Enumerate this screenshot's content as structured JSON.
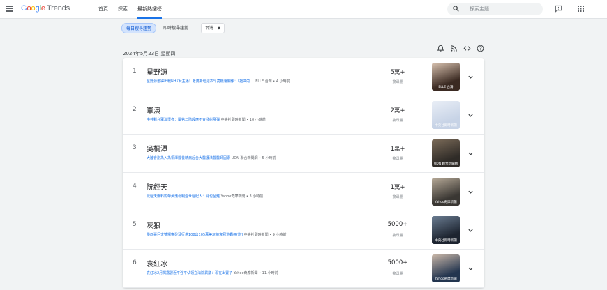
{
  "header": {
    "logo": {
      "google": [
        "G",
        "o",
        "o",
        "g",
        "l",
        "e"
      ],
      "product": "Trends"
    },
    "nav": [
      {
        "label": "首頁"
      },
      {
        "label": "探索"
      },
      {
        "label": "最新熱搜榜"
      }
    ],
    "search_placeholder": "探索主題"
  },
  "filters": {
    "daily_label": "每日搜尋趨勢",
    "realtime_label": "即時搜尋趨勢",
    "region": "台灣"
  },
  "date": "2024年5月23日 星期四",
  "count_label": "搜尋量",
  "trends": [
    {
      "rank": "1",
      "title": "星野源",
      "article": "星野源邀得出戰NHK女主播！老婆新垣結衣早亮機會關係：「扭曲的 ...",
      "source": "ELLE 台灣",
      "time": "4 小時前",
      "count": "5萬+",
      "thumb_source": "ELLE 台灣",
      "thumb_colors": [
        "#3b2a22",
        "#d8c2b0"
      ]
    },
    {
      "rank": "2",
      "title": "軍演",
      "article": "中共對台軍演學者：屬第二階段應不會發射飛彈",
      "source": "中央社即時新聞",
      "time": "10 小時前",
      "count": "2萬+",
      "thumb_source": "中央社即時新聞",
      "thumb_colors": [
        "#c7d3e6",
        "#e9eef6"
      ]
    },
    {
      "rank": "3",
      "title": "吳桐潭",
      "article": "大陸會劃為入為桐潭醫養精病起台大醫護法醫醫師因素",
      "source": "UDN 聯合新聞網",
      "time": "5 小時前",
      "count": "1萬+",
      "thumb_source": "UDN 聯合新聞網",
      "thumb_colors": [
        "#2f2b27",
        "#7a6a58"
      ]
    },
    {
      "rank": "4",
      "title": "阮經天",
      "article": "阮經天爆料影帝黃渤母親過世經紀人：絲也至難",
      "source": "Yahoo奇摩新聞",
      "time": "3 小時前",
      "count": "1萬+",
      "thumb_source": "Yahoo奇摩新聞",
      "thumb_colors": [
        "#3a3733",
        "#b7aa98"
      ]
    },
    {
      "rank": "5",
      "title": "灰狼",
      "article": "墨西哥巨文雙場寄發薄行供108出105萬美灰狼奪冠遊轟冊[影]",
      "source": "中央社即時新聞",
      "time": "9 小時前",
      "count": "5000+",
      "thumb_source": "中央社即時新聞",
      "thumb_colors": [
        "#1d2430",
        "#6b7d92"
      ]
    },
    {
      "rank": "6",
      "title": "袁紅冰",
      "article": "袁紅冰2月揭露習近平強平佔領立法院異議：現在出置了",
      "source": "Yahoo奇摩新聞",
      "time": "11 小時前",
      "count": "5000+",
      "thumb_source": "Yahoo奇摩新聞",
      "thumb_colors": [
        "#23354f",
        "#c9b7a8"
      ]
    }
  ]
}
